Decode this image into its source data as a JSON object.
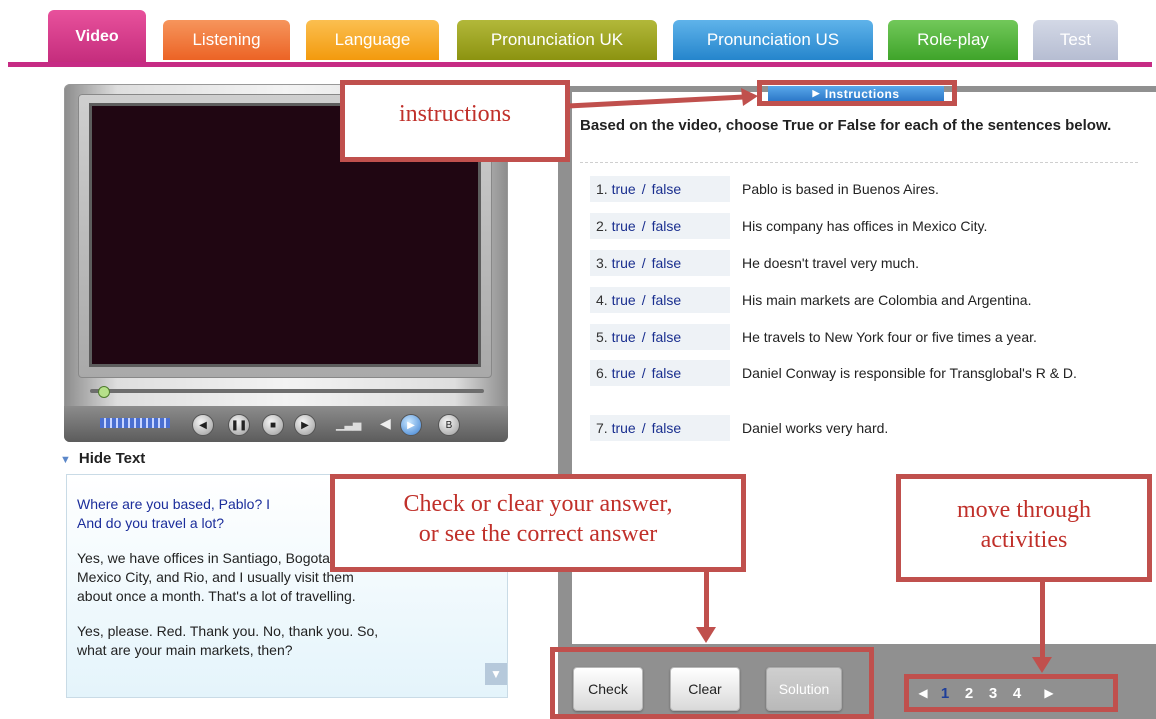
{
  "tabs": [
    {
      "label": "Video",
      "color": "#d63d8c",
      "active": true
    },
    {
      "label": "Listening",
      "color": "#f07838"
    },
    {
      "label": "Language",
      "color": "#f8a51b"
    },
    {
      "label": "Pronunciation UK",
      "color": "#9aa114"
    },
    {
      "label": "Pronunciation US",
      "color": "#3a9ad8"
    },
    {
      "label": "Role-play",
      "color": "#53b53b"
    },
    {
      "label": "Test",
      "color": "#c3c9dc"
    }
  ],
  "player": {
    "icons": [
      "volume-bars-icon",
      "rewind-icon",
      "pause-icon",
      "stop-icon",
      "fast-forward-icon",
      "signal-icon",
      "speaker-icon",
      "play-icon",
      "extra-icon"
    ]
  },
  "hide_text_label": "Hide Text",
  "transcript": {
    "question": "Where are you based, Pablo? I... And do you travel a lot?",
    "question_line1": "Where are you based, Pablo? I",
    "question_line2": "And do you travel a lot?",
    "answer1_line1": "Yes, we have offices in Santiago, Bogota,",
    "answer1_line2": "Mexico City, and Rio, and I usually visit them",
    "answer1_line3": "about once a month. That's a lot of travelling.",
    "answer2_line1": "Yes, please. Red. Thank you. No, thank you. So,",
    "answer2_line2": "what are your main markets, then?"
  },
  "instructions_button": "Instructions",
  "prompt": "Based on the video, choose True or False for each of the sentences below.",
  "true_label": "true",
  "false_label": "false",
  "separator": "/",
  "questions": [
    {
      "num": "1.",
      "text": "Pablo is based in Buenos Aires."
    },
    {
      "num": "2.",
      "text": "His company has offices in Mexico City."
    },
    {
      "num": "3.",
      "text": "He doesn't travel very much."
    },
    {
      "num": "4.",
      "text": "His main markets are Colombia and Argentina."
    },
    {
      "num": "5.",
      "text": "He travels to New York four or five times a year."
    },
    {
      "num": "6.",
      "text": "Daniel Conway is responsible for Transglobal's R & D."
    },
    {
      "num": "7.",
      "text": "Daniel works very hard."
    }
  ],
  "buttons": {
    "check": "Check",
    "clear": "Clear",
    "solution": "Solution"
  },
  "pager": {
    "pages": [
      "1",
      "2",
      "3",
      "4"
    ],
    "current": "1"
  },
  "callouts": {
    "instructions": "instructions",
    "check_line1": "Check or clear your answer,",
    "check_line2": "or see the correct answer",
    "move_line1": "move through",
    "move_line2": "activities"
  },
  "colors": {
    "accent": "#c62b84",
    "callout": "#c0504d",
    "link": "#1a2f8f"
  }
}
